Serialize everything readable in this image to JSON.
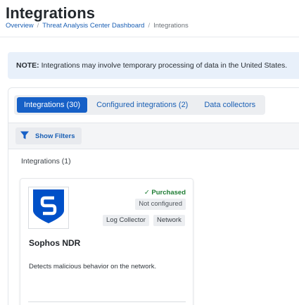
{
  "page": {
    "title": "Integrations"
  },
  "breadcrumb": {
    "items": [
      "Overview",
      "Threat Analysis Center Dashboard",
      "Integrations"
    ],
    "separator": "/"
  },
  "note": {
    "label": "NOTE:",
    "text": " Integrations may involve temporary processing of data in the United States."
  },
  "tabs": [
    {
      "label": "Integrations (30)",
      "active": true
    },
    {
      "label": "Configured integrations (2)",
      "active": false
    },
    {
      "label": "Data collectors",
      "active": false
    }
  ],
  "filters": {
    "button_label": "Show Filters",
    "icon": "filter-icon"
  },
  "section": {
    "label": "Integrations (1)"
  },
  "card": {
    "logo_icon": "sophos-shield-icon",
    "status": "Purchased",
    "status_icon": "checkmark-icon",
    "config_state": "Not configured",
    "tags": [
      "Log Collector",
      "Network"
    ],
    "title": "Sophos NDR",
    "description": "Detects malicious behavior on the network."
  },
  "colors": {
    "accent": "#1660c7",
    "link": "#1a5fb4",
    "success": "#1e7d34",
    "banner_bg": "#e8f0fa",
    "sophos_blue": "#0050c8"
  }
}
